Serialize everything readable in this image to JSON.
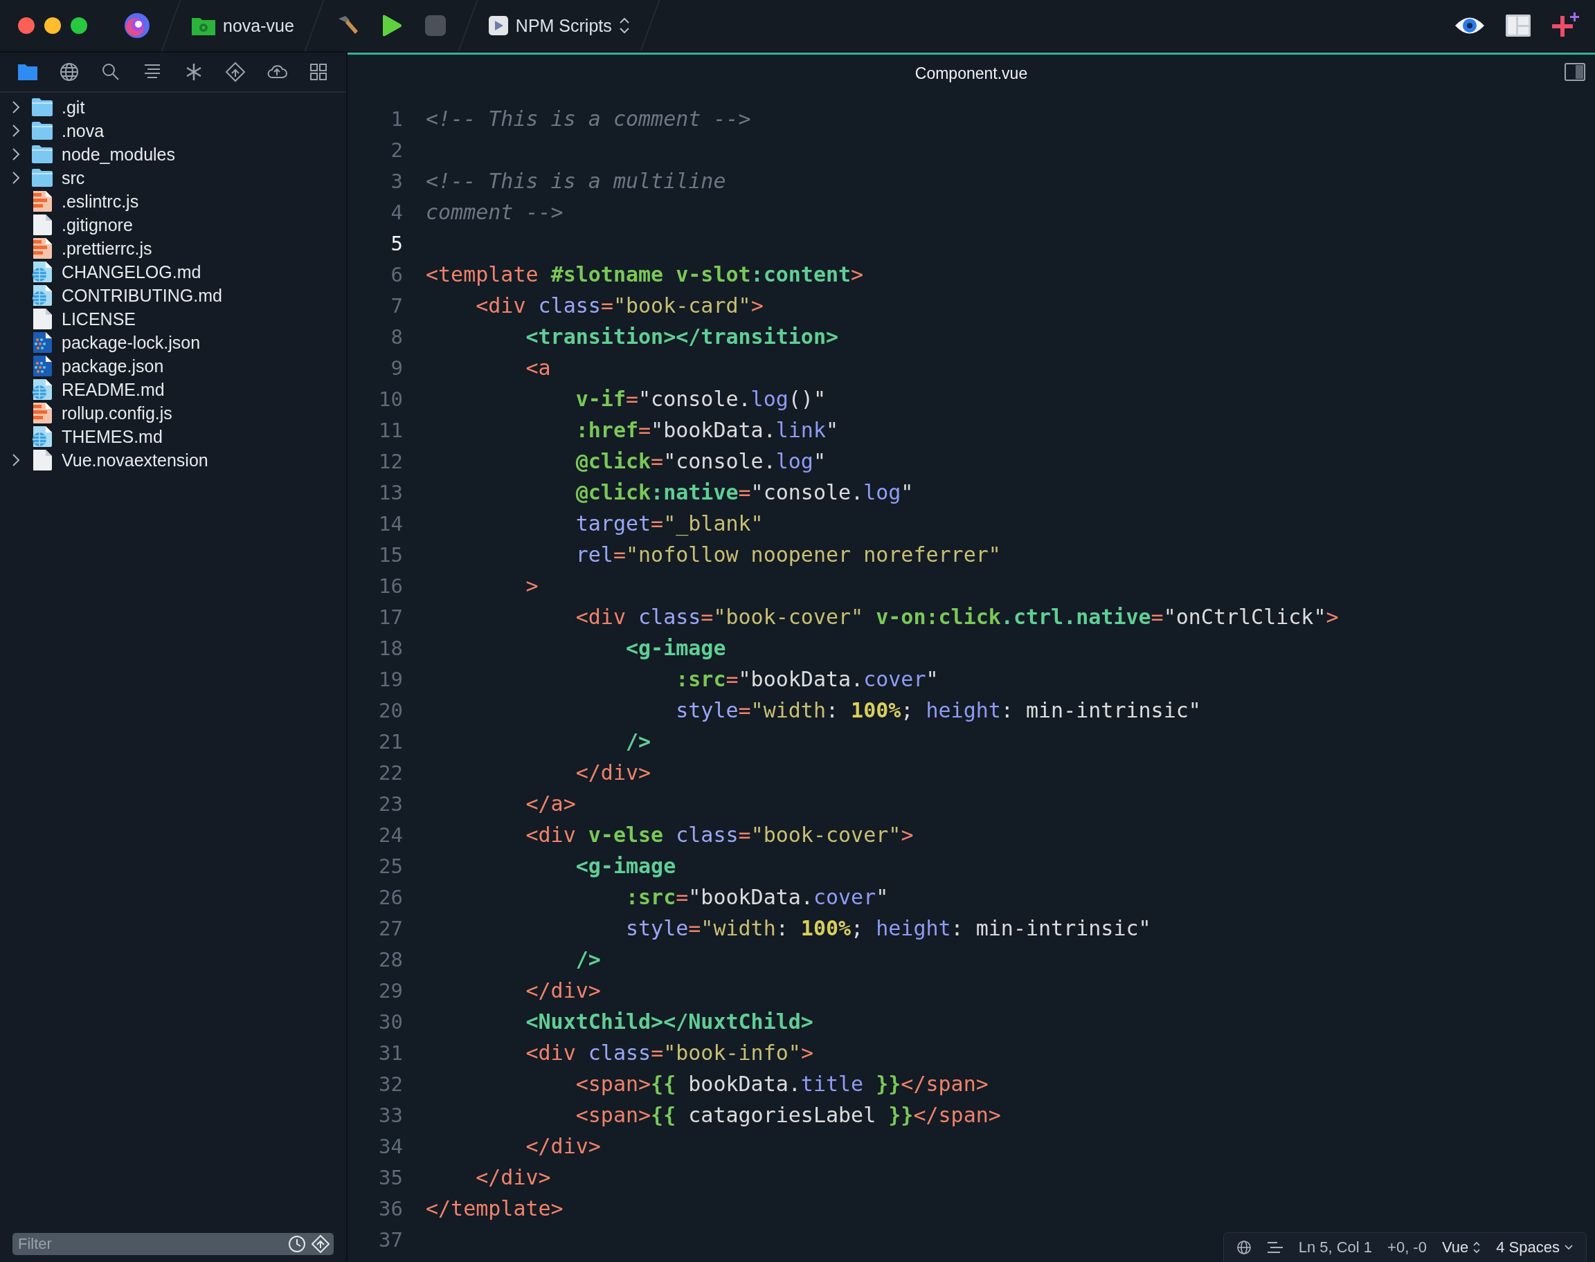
{
  "toolbar": {
    "project": "nova-vue",
    "task": "NPM Scripts"
  },
  "sidebar": {
    "tools": [
      {
        "kind": "files",
        "selected": true
      },
      {
        "kind": "globe",
        "selected": false
      },
      {
        "kind": "search",
        "selected": false
      },
      {
        "kind": "symbols",
        "selected": false
      },
      {
        "kind": "asterisk",
        "selected": false
      },
      {
        "kind": "git",
        "selected": false
      },
      {
        "kind": "cloud",
        "selected": false
      },
      {
        "kind": "grid",
        "selected": false
      }
    ],
    "tree": [
      {
        "name": ".git",
        "kind": "folder",
        "expandable": true
      },
      {
        "name": ".nova",
        "kind": "folder",
        "expandable": true
      },
      {
        "name": "node_modules",
        "kind": "folder",
        "expandable": true
      },
      {
        "name": "src",
        "kind": "folder",
        "expandable": true
      },
      {
        "name": ".eslintrc.js",
        "kind": "js",
        "expandable": false
      },
      {
        "name": ".gitignore",
        "kind": "plain",
        "expandable": false
      },
      {
        "name": ".prettierrc.js",
        "kind": "js",
        "expandable": false
      },
      {
        "name": "CHANGELOG.md",
        "kind": "md",
        "expandable": false
      },
      {
        "name": "CONTRIBUTING.md",
        "kind": "md",
        "expandable": false
      },
      {
        "name": "LICENSE",
        "kind": "plain",
        "expandable": false
      },
      {
        "name": "package-lock.json",
        "kind": "json",
        "expandable": false
      },
      {
        "name": "package.json",
        "kind": "json",
        "expandable": false
      },
      {
        "name": "README.md",
        "kind": "md",
        "expandable": false
      },
      {
        "name": "rollup.config.js",
        "kind": "js",
        "expandable": false
      },
      {
        "name": "THEMES.md",
        "kind": "md",
        "expandable": false
      },
      {
        "name": "Vue.novaextension",
        "kind": "plain",
        "expandable": true
      }
    ],
    "filter": {
      "placeholder": "Filter"
    }
  },
  "editor": {
    "tab": "Component.vue",
    "lines": [
      {
        "number": "1",
        "current": false,
        "tokens": [
          {
            "kind": "comment",
            "text": "<!-- This is a comment -->"
          }
        ]
      },
      {
        "number": "2",
        "current": false
      },
      {
        "number": "3",
        "current": false,
        "tokens": [
          {
            "kind": "comment",
            "text": "<!-- This is a multiline"
          }
        ]
      },
      {
        "number": "4",
        "current": false,
        "tokens": [
          {
            "kind": "comment",
            "text": "comment -->"
          }
        ]
      },
      {
        "number": "5",
        "current": true
      },
      {
        "number": "6",
        "current": false,
        "tokens": [
          {
            "kind": "tag",
            "text": "<template "
          },
          {
            "kind": "directive",
            "text": "#slotname v-slot"
          },
          {
            "kind": "component",
            "text": ":content"
          },
          {
            "kind": "tag",
            "text": ">"
          }
        ]
      },
      {
        "number": "7",
        "current": false,
        "tokens": [
          {
            "kind": "tag",
            "text": "    <div "
          },
          {
            "kind": "attr",
            "text": "class"
          },
          {
            "kind": "tag",
            "text": "="
          },
          {
            "kind": "string",
            "text": "\"book-card\""
          },
          {
            "kind": "tag",
            "text": ">"
          }
        ]
      },
      {
        "number": "8",
        "current": false,
        "tokens": [
          {
            "kind": "component",
            "text": "        <transition></transition>"
          }
        ]
      },
      {
        "number": "9",
        "current": false,
        "tokens": [
          {
            "kind": "tag",
            "text": "        <a"
          }
        ]
      },
      {
        "number": "10",
        "current": false,
        "tokens": [
          {
            "kind": "directive",
            "text": "            v-if"
          },
          {
            "kind": "tag",
            "text": "="
          },
          {
            "kind": "text",
            "text": "\"console."
          },
          {
            "kind": "member",
            "text": "log"
          },
          {
            "kind": "text",
            "text": "()\""
          }
        ]
      },
      {
        "number": "11",
        "current": false,
        "tokens": [
          {
            "kind": "directive",
            "text": "            :href"
          },
          {
            "kind": "tag",
            "text": "="
          },
          {
            "kind": "text",
            "text": "\"bookData."
          },
          {
            "kind": "member",
            "text": "link"
          },
          {
            "kind": "text",
            "text": "\""
          }
        ]
      },
      {
        "number": "12",
        "current": false,
        "tokens": [
          {
            "kind": "directive",
            "text": "            @click"
          },
          {
            "kind": "tag",
            "text": "="
          },
          {
            "kind": "text",
            "text": "\"console."
          },
          {
            "kind": "member",
            "text": "log"
          },
          {
            "kind": "text",
            "text": "\""
          }
        ]
      },
      {
        "number": "13",
        "current": false,
        "tokens": [
          {
            "kind": "directive",
            "text": "            @click"
          },
          {
            "kind": "component",
            "text": ":native"
          },
          {
            "kind": "tag",
            "text": "="
          },
          {
            "kind": "text",
            "text": "\"console."
          },
          {
            "kind": "member",
            "text": "log"
          },
          {
            "kind": "text",
            "text": "\""
          }
        ]
      },
      {
        "number": "14",
        "current": false,
        "tokens": [
          {
            "kind": "attr",
            "text": "            target"
          },
          {
            "kind": "tag",
            "text": "="
          },
          {
            "kind": "string",
            "text": "\"_blank\""
          }
        ]
      },
      {
        "number": "15",
        "current": false,
        "tokens": [
          {
            "kind": "attr",
            "text": "            rel"
          },
          {
            "kind": "tag",
            "text": "="
          },
          {
            "kind": "string",
            "text": "\"nofollow noopener noreferrer\""
          }
        ]
      },
      {
        "number": "16",
        "current": false,
        "tokens": [
          {
            "kind": "tag",
            "text": "        >"
          }
        ]
      },
      {
        "number": "17",
        "current": false,
        "tokens": [
          {
            "kind": "tag",
            "text": "            <div "
          },
          {
            "kind": "attr",
            "text": "class"
          },
          {
            "kind": "tag",
            "text": "="
          },
          {
            "kind": "string",
            "text": "\"book-cover\" "
          },
          {
            "kind": "directive",
            "text": "v-on:click"
          },
          {
            "kind": "component",
            "text": ".ctrl.native"
          },
          {
            "kind": "tag",
            "text": "="
          },
          {
            "kind": "text",
            "text": "\"onCtrlClick\""
          },
          {
            "kind": "tag",
            "text": ">"
          }
        ]
      },
      {
        "number": "18",
        "current": false,
        "tokens": [
          {
            "kind": "component",
            "text": "                <g-image"
          }
        ]
      },
      {
        "number": "19",
        "current": false,
        "tokens": [
          {
            "kind": "directive",
            "text": "                    :src"
          },
          {
            "kind": "tag",
            "text": "="
          },
          {
            "kind": "text",
            "text": "\"bookData."
          },
          {
            "kind": "member",
            "text": "cover"
          },
          {
            "kind": "text",
            "text": "\""
          }
        ]
      },
      {
        "number": "20",
        "current": false,
        "tokens": [
          {
            "kind": "attr",
            "text": "                    style"
          },
          {
            "kind": "tag",
            "text": "="
          },
          {
            "kind": "string",
            "text": "\"width"
          },
          {
            "kind": "text",
            "text": ": "
          },
          {
            "kind": "number",
            "text": "100%"
          },
          {
            "kind": "text",
            "text": "; "
          },
          {
            "kind": "member",
            "text": "height"
          },
          {
            "kind": "text",
            "text": ": min-intrinsic\""
          }
        ]
      },
      {
        "number": "21",
        "current": false,
        "tokens": [
          {
            "kind": "component",
            "text": "                />"
          }
        ]
      },
      {
        "number": "22",
        "current": false,
        "tokens": [
          {
            "kind": "tag",
            "text": "            </div>"
          }
        ]
      },
      {
        "number": "23",
        "current": false,
        "tokens": [
          {
            "kind": "tag",
            "text": "        </a>"
          }
        ]
      },
      {
        "number": "24",
        "current": false,
        "tokens": [
          {
            "kind": "tag",
            "text": "        <div "
          },
          {
            "kind": "directive",
            "text": "v-else "
          },
          {
            "kind": "attr",
            "text": "class"
          },
          {
            "kind": "tag",
            "text": "="
          },
          {
            "kind": "string",
            "text": "\"book-cover\""
          },
          {
            "kind": "tag",
            "text": ">"
          }
        ]
      },
      {
        "number": "25",
        "current": false,
        "tokens": [
          {
            "kind": "component",
            "text": "            <g-image"
          }
        ]
      },
      {
        "number": "26",
        "current": false,
        "tokens": [
          {
            "kind": "directive",
            "text": "                :src"
          },
          {
            "kind": "tag",
            "text": "="
          },
          {
            "kind": "text",
            "text": "\"bookData."
          },
          {
            "kind": "member",
            "text": "cover"
          },
          {
            "kind": "text",
            "text": "\""
          }
        ]
      },
      {
        "number": "27",
        "current": false,
        "tokens": [
          {
            "kind": "attr",
            "text": "                style"
          },
          {
            "kind": "tag",
            "text": "="
          },
          {
            "kind": "string",
            "text": "\"width"
          },
          {
            "kind": "text",
            "text": ": "
          },
          {
            "kind": "number",
            "text": "100%"
          },
          {
            "kind": "text",
            "text": "; "
          },
          {
            "kind": "member",
            "text": "height"
          },
          {
            "kind": "text",
            "text": ": min-intrinsic\""
          }
        ]
      },
      {
        "number": "28",
        "current": false,
        "tokens": [
          {
            "kind": "component",
            "text": "            />"
          }
        ]
      },
      {
        "number": "29",
        "current": false,
        "tokens": [
          {
            "kind": "tag",
            "text": "        </div>"
          }
        ]
      },
      {
        "number": "30",
        "current": false,
        "tokens": [
          {
            "kind": "component",
            "text": "        <NuxtChild></NuxtChild>"
          }
        ]
      },
      {
        "number": "31",
        "current": false,
        "tokens": [
          {
            "kind": "tag",
            "text": "        <div "
          },
          {
            "kind": "attr",
            "text": "class"
          },
          {
            "kind": "tag",
            "text": "="
          },
          {
            "kind": "string",
            "text": "\"book-info\""
          },
          {
            "kind": "tag",
            "text": ">"
          }
        ]
      },
      {
        "number": "32",
        "current": false,
        "tokens": [
          {
            "kind": "tag",
            "text": "            <span>"
          },
          {
            "kind": "directive",
            "text": "{{"
          },
          {
            "kind": "text",
            "text": " bookData."
          },
          {
            "kind": "member",
            "text": "title "
          },
          {
            "kind": "directive",
            "text": "}}"
          },
          {
            "kind": "tag",
            "text": "</span>"
          }
        ]
      },
      {
        "number": "33",
        "current": false,
        "tokens": [
          {
            "kind": "tag",
            "text": "            <span>"
          },
          {
            "kind": "directive",
            "text": "{{"
          },
          {
            "kind": "text",
            "text": " catagoriesLabel "
          },
          {
            "kind": "directive",
            "text": "}}"
          },
          {
            "kind": "tag",
            "text": "</span>"
          }
        ]
      },
      {
        "number": "34",
        "current": false,
        "tokens": [
          {
            "kind": "tag",
            "text": "        </div>"
          }
        ]
      },
      {
        "number": "35",
        "current": false,
        "tokens": [
          {
            "kind": "tag",
            "text": "    </div>"
          }
        ]
      },
      {
        "number": "36",
        "current": false,
        "tokens": [
          {
            "kind": "tag",
            "text": "</template>"
          }
        ]
      },
      {
        "number": "37",
        "current": false
      }
    ]
  },
  "status_bar": {
    "position": "Ln 5, Col 1",
    "changes": "+0, -0",
    "syntax": "Vue",
    "indentation": "4 Spaces"
  }
}
